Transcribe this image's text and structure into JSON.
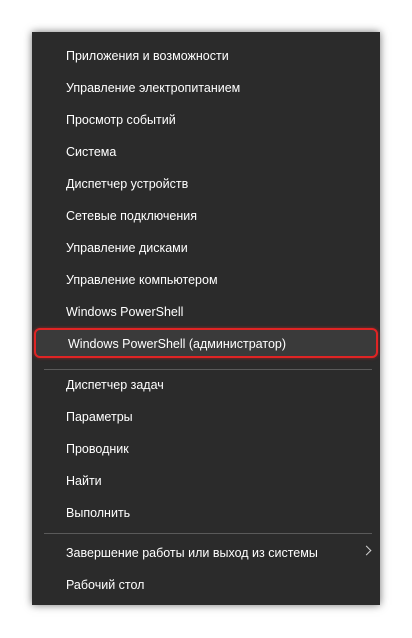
{
  "menu": {
    "items": [
      {
        "label": "Приложения и возможности"
      },
      {
        "label": "Управление электропитанием"
      },
      {
        "label": "Просмотр событий"
      },
      {
        "label": "Система"
      },
      {
        "label": "Диспетчер устройств"
      },
      {
        "label": "Сетевые подключения"
      },
      {
        "label": "Управление дисками"
      },
      {
        "label": "Управление компьютером"
      },
      {
        "label": "Windows PowerShell"
      },
      {
        "label": "Windows PowerShell (администратор)"
      },
      {
        "label": "Диспетчер задач"
      },
      {
        "label": "Параметры"
      },
      {
        "label": "Проводник"
      },
      {
        "label": "Найти"
      },
      {
        "label": "Выполнить"
      },
      {
        "label": "Завершение работы или выход из системы"
      },
      {
        "label": "Рабочий стол"
      }
    ]
  },
  "colors": {
    "menu_background": "#2b2b2b",
    "highlight_border": "#e02424",
    "text": "#ffffff"
  },
  "icons": {
    "submenu": "chevron-right-icon"
  }
}
